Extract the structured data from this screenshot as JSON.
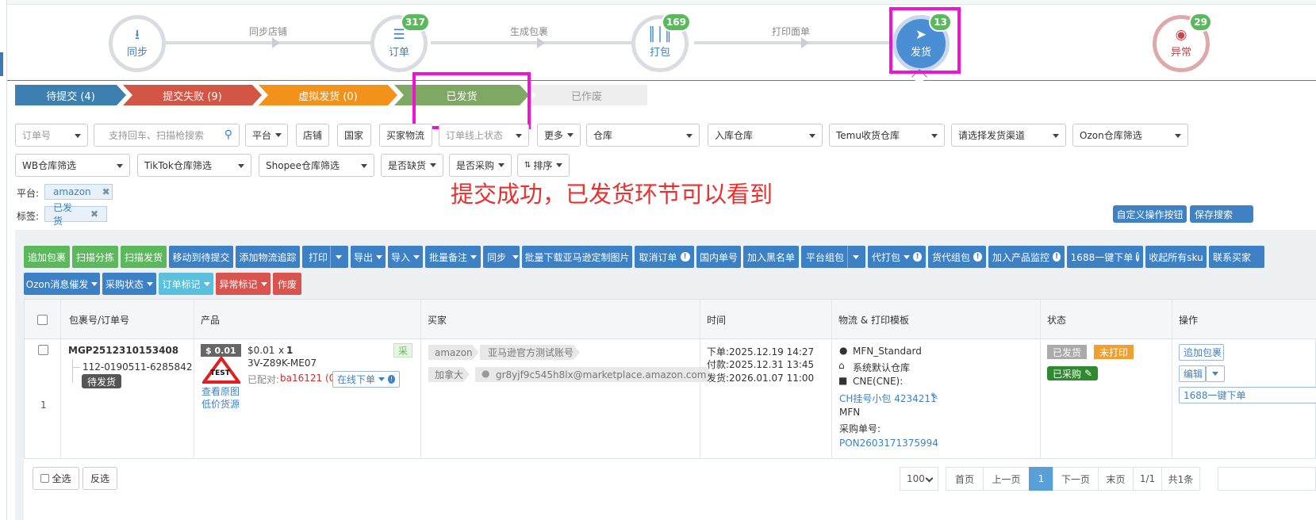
{
  "workflow": {
    "steps": [
      {
        "label": "同步",
        "icon": "download-icon"
      },
      {
        "label": "订单",
        "badge": "317",
        "icon": "list-icon"
      },
      {
        "label": "打包",
        "badge": "169",
        "icon": "barcode-icon"
      },
      {
        "label": "发货",
        "badge": "13",
        "icon": "paper-plane-icon"
      },
      {
        "label": "异常",
        "badge": "29",
        "icon": "eye-slash-icon"
      }
    ],
    "connectors": [
      "同步店铺",
      "生成包裹",
      "打印面单"
    ]
  },
  "status_tabs": [
    {
      "label": "待提交 (4)",
      "color": "#3d7fb1"
    },
    {
      "label": "提交失败 (9)",
      "color": "#d35545"
    },
    {
      "label": "虚拟发货 (0)",
      "color": "#f3921a"
    },
    {
      "label": "已发货",
      "color": "#7fa864"
    },
    {
      "label": "已作废",
      "color": "#eeeeee"
    }
  ],
  "filters": {
    "order_no": "订单号",
    "search_placeholder": "支持回车、扫描枪搜索",
    "platform": "平台",
    "store": "店铺",
    "country": "国家",
    "buyer_logistics": "买家物流",
    "online_status": "订单线上状态",
    "more": "更多",
    "warehouse": "仓库",
    "inbound_warehouse": "入库仓库",
    "temu_warehouse": "Temu收货仓库",
    "shipping_channel": "请选择发货渠道",
    "ozon_warehouse": "Ozon仓库筛选",
    "wb_warehouse": "WB仓库筛选",
    "tiktok_warehouse": "TikTok仓库筛选",
    "shopee_warehouse": "Shopee仓库筛选",
    "out_of_stock": "是否缺货",
    "purchased": "是否采购",
    "sort": "排序"
  },
  "active_filters": {
    "platform_label": "平台:",
    "platform_value": "amazon",
    "tag_label": "标签:",
    "tag_value": "已发货",
    "remove_glyph": "✖"
  },
  "annotation": "提交成功，已发货环节可以看到",
  "right_buttons": {
    "custom_ops": "自定义操作按钮",
    "save_search": "保存搜索"
  },
  "toolbar_row1": [
    {
      "label": "追加包裹",
      "color": "g"
    },
    {
      "label": "扫描分拣",
      "color": "g"
    },
    {
      "label": "扫描发货",
      "color": "g"
    },
    {
      "label": "移动到待提交",
      "color": "b"
    },
    {
      "label": "添加物流追踪",
      "color": "b"
    },
    {
      "label": "打印",
      "color": "b",
      "split": true
    },
    {
      "label": "导出",
      "color": "b",
      "dropdown": true
    },
    {
      "label": "导入",
      "color": "b",
      "dropdown": true
    },
    {
      "label": "批量备注",
      "color": "b",
      "dropdown": true
    },
    {
      "label": "同步",
      "color": "b",
      "split": true
    },
    {
      "label": "批量下载亚马逊定制图片",
      "color": "b"
    },
    {
      "label": "取消订单",
      "color": "b",
      "info": true
    },
    {
      "label": "国内单号",
      "color": "b"
    },
    {
      "label": "加入黑名单",
      "color": "b"
    },
    {
      "label": "平台组包",
      "color": "b",
      "split": true
    },
    {
      "label": "代打包",
      "color": "b",
      "dropdown": true,
      "info": true
    },
    {
      "label": "货代组包",
      "color": "b",
      "info": true
    },
    {
      "label": "加入产品监控",
      "color": "b",
      "info": true
    },
    {
      "label": "1688一键下单",
      "color": "b",
      "info": true
    },
    {
      "label": "收起所有sku",
      "color": "b"
    },
    {
      "label": "联系买家",
      "color": "b"
    }
  ],
  "toolbar_row2": [
    {
      "label": "Ozon消息催发",
      "color": "b",
      "dropdown": true
    },
    {
      "label": "采购状态",
      "color": "b",
      "dropdown": true
    },
    {
      "label": "订单标记",
      "color": "cy",
      "dropdown": true
    },
    {
      "label": "异常标记",
      "color": "r",
      "dropdown": true
    },
    {
      "label": "作废",
      "color": "r"
    }
  ],
  "table": {
    "headers": [
      "包裹号/订单号",
      "产品",
      "买家",
      "时间",
      "物流 & 打印模板",
      "状态",
      "操作"
    ],
    "row": {
      "index": "1",
      "package_no": "MGP2512310153408",
      "order_no": "112-0190511-6285842",
      "order_tag": "待发货",
      "price_tag": "$ 0.01",
      "test_label": "TEST",
      "view_image": "查看原图",
      "low_price_source": "低价货源",
      "price": "$0.01",
      "qty_prefix": "x",
      "qty": "1",
      "sku": "3V-Z89K-ME07",
      "matched_label": "已配对:",
      "matched_value": "ba16121 (0)",
      "online_order": "在线下单",
      "purchase_mark": "采",
      "buyer_platform": "amazon",
      "buyer_account": "亚马逊官方测试账号",
      "buyer_country": "加拿大",
      "buyer_email": "gr8yjf9c545h8lx@marketplace.amazon.com",
      "time_order": "下单:2025.12.19 14:27",
      "time_paid": "付款:2025.12.31 13:45",
      "time_shipped": "发货:2026.01.07 11:00",
      "logistics_template": "MFN_Standard",
      "logistics_warehouse": "系统默认仓库",
      "logistics_carrier": "CNE(CNE):",
      "logistics_service": "CH挂号小包 4234211",
      "logistics_mfn": "MFN",
      "purchase_no_label": "采购单号:",
      "purchase_no": "PON2603171375994",
      "status_shipped": "已发货",
      "status_unprinted": "未打印",
      "status_purchased": "已采购",
      "action_add_package": "追加包裹",
      "action_edit": "编辑",
      "action_1688": "1688一键下单"
    }
  },
  "footer": {
    "select_all": "全选",
    "invert": "反选",
    "page_size": "100",
    "first": "首页",
    "prev": "上一页",
    "current": "1",
    "next": "下一页",
    "last": "末页",
    "page_info": "1/1",
    "total": "共1条"
  }
}
